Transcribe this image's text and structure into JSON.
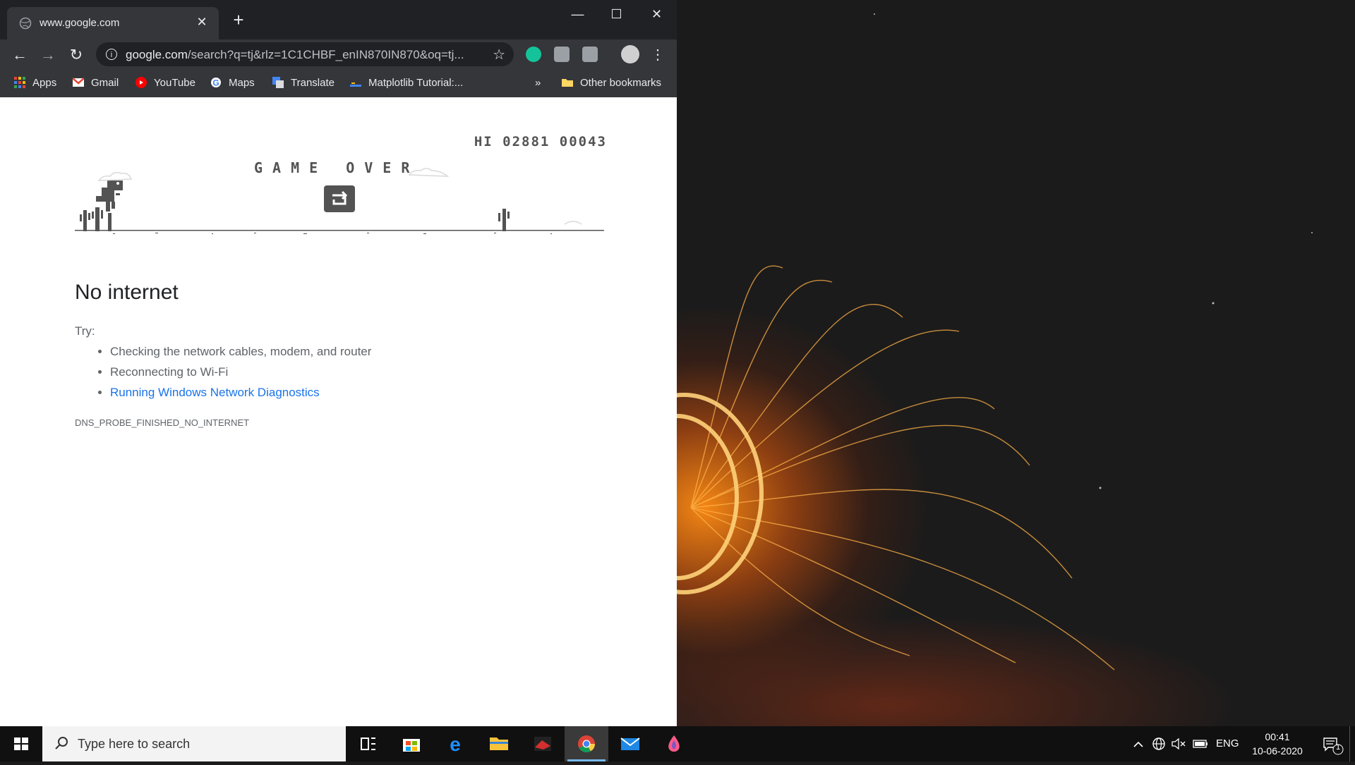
{
  "browser": {
    "tab": {
      "title": "www.google.com"
    },
    "omnibox": {
      "host": "google.com",
      "path": "/search?q=tj&rlz=1C1CHBF_enIN870IN870&oq=tj..."
    },
    "bookmarks": [
      {
        "label": "Apps",
        "icon": "apps-grid-icon"
      },
      {
        "label": "Gmail",
        "icon": "gmail-icon"
      },
      {
        "label": "YouTube",
        "icon": "youtube-icon"
      },
      {
        "label": "Maps",
        "icon": "google-icon"
      },
      {
        "label": "Translate",
        "icon": "translate-icon"
      },
      {
        "label": "Matplotlib Tutorial:...",
        "icon": "matplotlib-icon"
      }
    ],
    "bookmarks_overflow": "»",
    "other_bookmarks": "Other bookmarks"
  },
  "page": {
    "game": {
      "score": "HI 02881 00043",
      "game_over": "GAME OVER"
    },
    "heading": "No internet",
    "try_label": "Try:",
    "suggestions": [
      "Checking the network cables, modem, and router",
      "Reconnecting to Wi-Fi",
      "Running Windows Network Diagnostics"
    ],
    "error_code": "DNS_PROBE_FINISHED_NO_INTERNET"
  },
  "taskbar": {
    "search_placeholder": "Type here to search",
    "apps": [
      "task-view",
      "microsoft-store",
      "edge",
      "file-explorer",
      "game-app",
      "chrome",
      "mail",
      "paint-3d"
    ],
    "active_app": "chrome",
    "tray": {
      "language": "ENG",
      "time": "00:41",
      "date": "10-06-2020",
      "notification_count": "1"
    }
  },
  "colors": {
    "chrome_dark": "#202124",
    "toolbar": "#35363a",
    "link": "#1a73e8",
    "dino_gray": "#535353"
  }
}
